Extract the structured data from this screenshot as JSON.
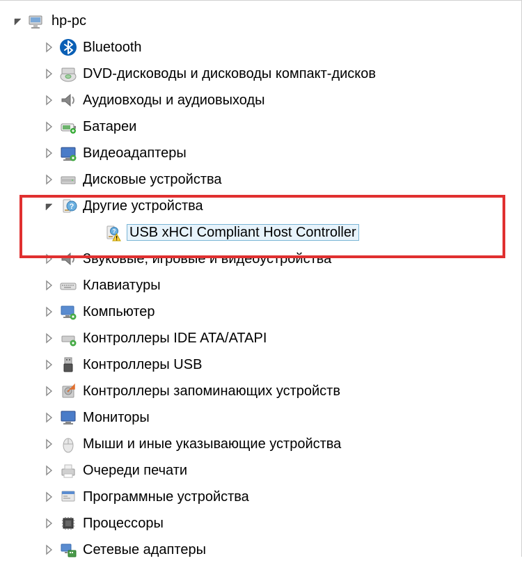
{
  "root": {
    "label": "hp-pc"
  },
  "categories": [
    {
      "label": "Bluetooth"
    },
    {
      "label": "DVD-дисководы и дисководы компакт-дисков"
    },
    {
      "label": "Аудиовходы и аудиовыходы"
    },
    {
      "label": "Батареи"
    },
    {
      "label": "Видеоадаптеры"
    },
    {
      "label": "Дисковые устройства"
    },
    {
      "label": "Другие устройства"
    },
    {
      "label": "Звуковые, игровые и видеоустройства"
    },
    {
      "label": "Клавиатуры"
    },
    {
      "label": "Компьютер"
    },
    {
      "label": "Контроллеры IDE ATA/ATAPI"
    },
    {
      "label": "Контроллеры USB"
    },
    {
      "label": "Контроллеры запоминающих устройств"
    },
    {
      "label": "Мониторы"
    },
    {
      "label": "Мыши и иные указывающие устройства"
    },
    {
      "label": "Очереди печати"
    },
    {
      "label": "Программные устройства"
    },
    {
      "label": "Процессоры"
    },
    {
      "label": "Сетевые адаптеры"
    }
  ],
  "problem_device": {
    "label": "USB xHCI Compliant Host Controller"
  }
}
